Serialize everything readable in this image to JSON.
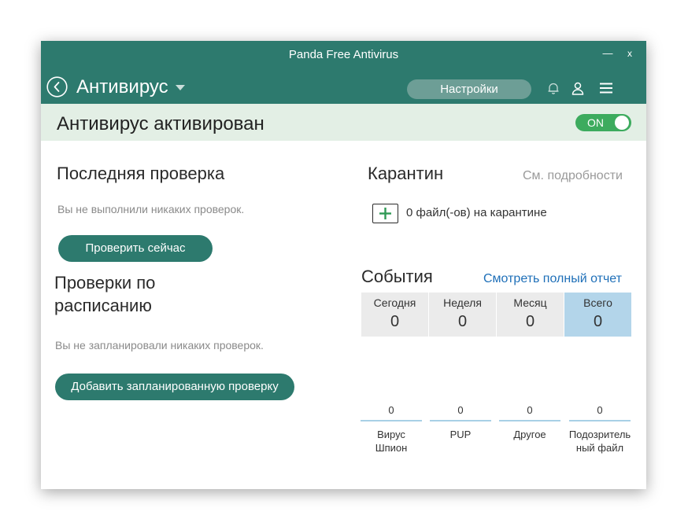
{
  "window": {
    "title": "Panda Free Antivirus",
    "minimize_label": "—",
    "close_label": "x"
  },
  "appbar": {
    "title": "Антивирус",
    "settings_label": "Настройки"
  },
  "status": {
    "text": "Антивирус активирован",
    "toggle_label": "ON"
  },
  "last_scan": {
    "title": "Последняя проверка",
    "message": "Вы не выполнили никаких проверок.",
    "button_label": "Проверить сейчас"
  },
  "scheduled": {
    "title_line1": "Проверки по",
    "title_line2": "расписанию",
    "message": "Вы не запланировали никаких проверок.",
    "button_label": "Добавить запланированную проверку"
  },
  "quarantine": {
    "title": "Карантин",
    "details_link": "См. подробности",
    "count_text": "0 файл(-ов) на карантине"
  },
  "events": {
    "title": "События",
    "report_link": "Смотреть полный отчет",
    "periods": [
      {
        "label": "Сегодня",
        "value": "0"
      },
      {
        "label": "Неделя",
        "value": "0"
      },
      {
        "label": "Месяц",
        "value": "0"
      },
      {
        "label": "Всего",
        "value": "0"
      }
    ],
    "categories": [
      {
        "value": "0",
        "label_line1": "Вирус",
        "label_line2": "Шпион"
      },
      {
        "value": "0",
        "label_line1": "PUP",
        "label_line2": ""
      },
      {
        "value": "0",
        "label_line1": "Другое",
        "label_line2": ""
      },
      {
        "value": "0",
        "label_line1": "Подозритель",
        "label_line2": "ный файл"
      }
    ]
  },
  "colors": {
    "brand_teal": "#2d7a6e",
    "status_band": "#e3efe5",
    "toggle_on": "#3dab5e",
    "link_blue": "#1e6fb8",
    "selected_period": "#b3d5ea"
  }
}
